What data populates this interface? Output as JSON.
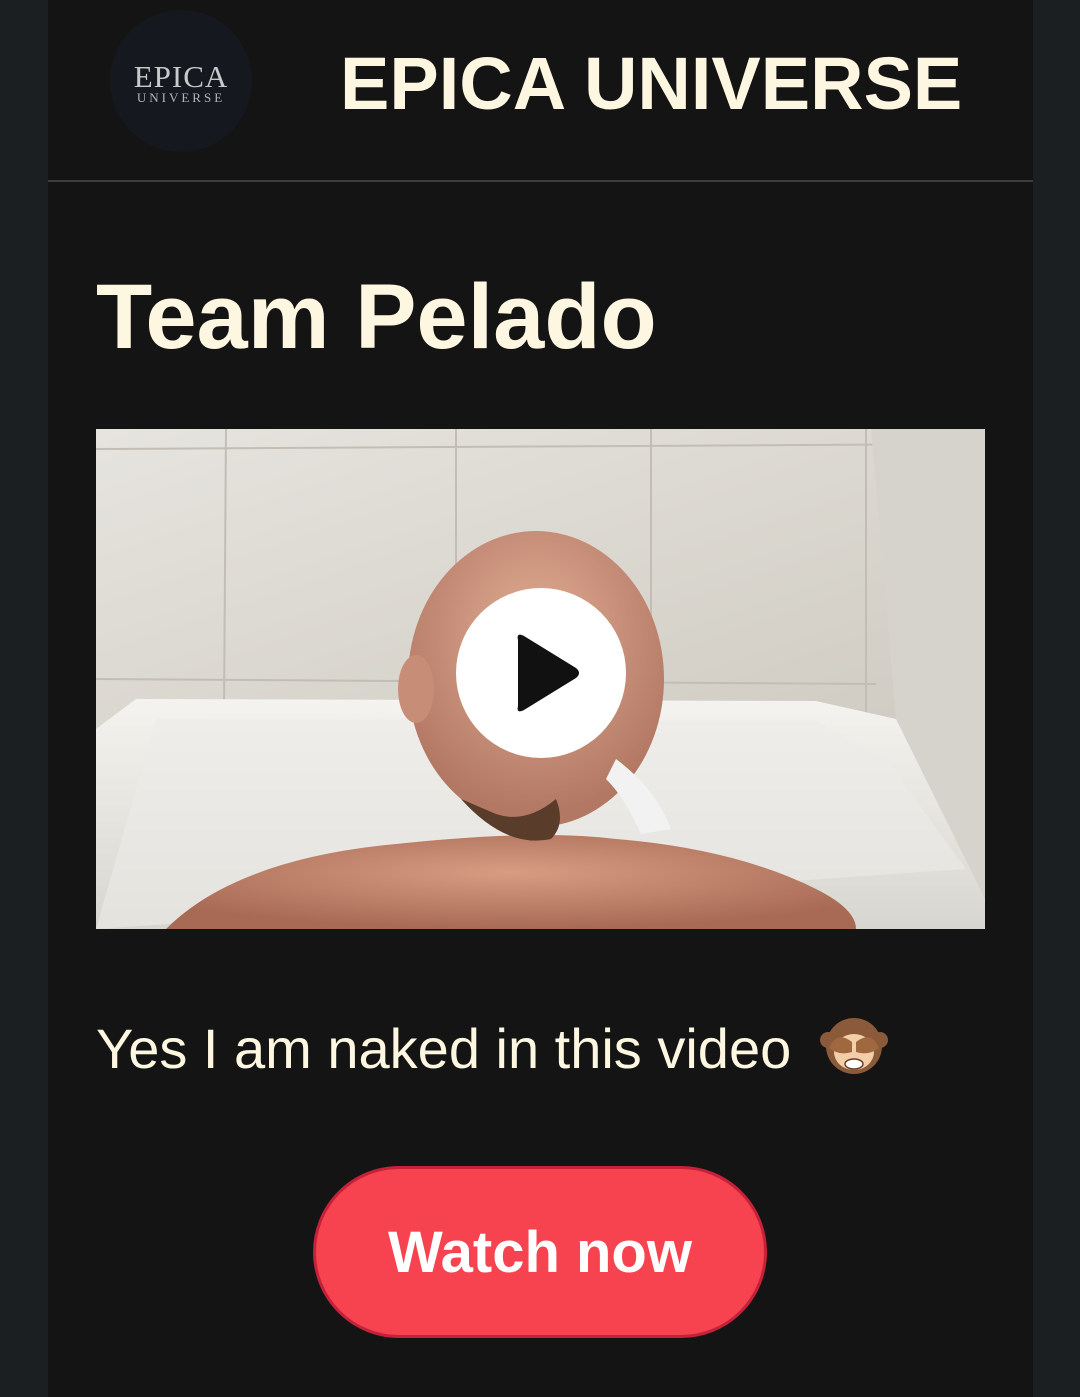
{
  "header": {
    "logo": {
      "line1": "EPICA",
      "line2": "UNIVERSE"
    },
    "site_title": "EPICA UNIVERSE"
  },
  "post": {
    "title": "Team Pelado",
    "video": {
      "thumbnail": "man-in-bathtub-thumbnail",
      "play_icon": "play-icon"
    },
    "caption": "Yes I am naked in this video",
    "caption_emoji": "see-no-evil-monkey-icon",
    "cta_label": "Watch now"
  },
  "colors": {
    "outer_background": "#1c1f22",
    "page_background": "#141414",
    "title_text": "#fdf6e0",
    "button_background": "#f7434f",
    "button_border": "#c6213b",
    "button_text": "#ffffff",
    "divider": "#3d3d3d"
  }
}
